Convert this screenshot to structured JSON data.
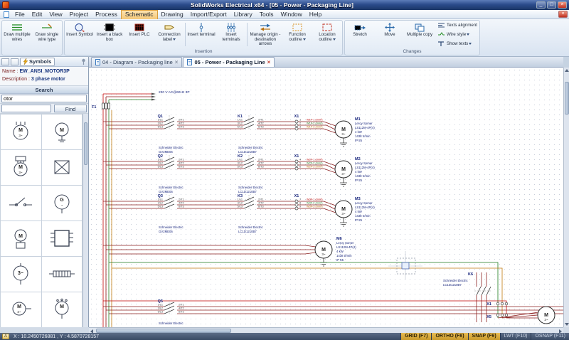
{
  "window": {
    "title": "SolidWorks Electrical x64 - [05 - Power - Packaging Line]"
  },
  "menu": {
    "items": [
      "File",
      "Edit",
      "View",
      "Project",
      "Process",
      "Schematic",
      "Drawing",
      "Import/Export",
      "Library",
      "Tools",
      "Window",
      "Help"
    ]
  },
  "ribbon": {
    "wire_group": {
      "buttons": [
        {
          "label": "Draw multiple wires"
        },
        {
          "label": "Draw single wire type"
        }
      ]
    },
    "insertion_group": {
      "label": "Insertion",
      "buttons": [
        {
          "label": "Insert Symbol"
        },
        {
          "label": "Insert a black box"
        },
        {
          "label": "Insert PLC"
        },
        {
          "label": "Connection label"
        },
        {
          "label": "Insert terminal"
        },
        {
          "label": "Insert terminals"
        },
        {
          "label": "Manage origin - destination arrows"
        },
        {
          "label": "Function outline"
        },
        {
          "label": "Location outline"
        }
      ]
    },
    "changes_group": {
      "label": "Changes",
      "buttons": [
        {
          "label": "Stretch"
        },
        {
          "label": "Move"
        },
        {
          "label": "Multiple copy"
        }
      ],
      "small_buttons": [
        {
          "label": "Texts alignment"
        },
        {
          "label": "Wire style"
        },
        {
          "label": "Show texts"
        }
      ]
    }
  },
  "doc_tabs": [
    {
      "label": "04 - Diagram - Packaging line"
    },
    {
      "label": "05 - Power - Packaging Line"
    }
  ],
  "sidebar": {
    "panel_tab": "Symbols",
    "name_label": "Name :",
    "name_value": "EW_ANSI_MOTOR3P",
    "desc_label": "Description :",
    "desc_value": "3 phase motor",
    "search_title": "Search",
    "search_value": "otor",
    "find_label": "Find",
    "symbols": [
      {
        "glyph": "M",
        "sub": "3~"
      },
      {
        "glyph": "M",
        "sub": ""
      },
      {
        "glyph": "M",
        "sub": "3~"
      },
      {
        "glyph": "",
        "sub": ""
      },
      {
        "glyph": "",
        "sub": ""
      },
      {
        "glyph": "G",
        "sub": "~"
      },
      {
        "glyph": "M",
        "sub": ""
      },
      {
        "glyph": "",
        "sub": ""
      },
      {
        "glyph": "3~",
        "sub": ""
      },
      {
        "glyph": "",
        "sub": ""
      },
      {
        "glyph": "M",
        "sub": "3~"
      },
      {
        "glyph": "M",
        "sub": ""
      }
    ]
  },
  "schematic": {
    "supply_label": "230 V AC@60Hz 3P",
    "fuse_tag": "F1",
    "motor_m": "M",
    "motor_ph": "3~",
    "pins": {
      "l1": "1/L1",
      "l2": "3/L2",
      "l3": "5/L3",
      "t1": "2/T1",
      "t2": "4/T2",
      "t3": "6/T3"
    },
    "branches": [
      {
        "breaker_tag": "Q1",
        "breaker_mfr": "Schneider Electric",
        "breaker_ref": "GV2ME06",
        "contactor_tag": "K1",
        "contactor_mfr": "Schneider Electric",
        "contactor_ref": "LC1D1210B7",
        "terminal_tag": "X1",
        "terminals": [
          "1",
          "2",
          "3"
        ],
        "wire_labels": [
          "W1F-1 (mm²)",
          "W1F-2 (mm²)",
          "W1F-3 (mm²)"
        ],
        "motor_tag": "M1",
        "motor_mfr": "Leroy Somer",
        "motor_ref": "LS112M-4P(4)",
        "motor_power": "4 kW",
        "motor_speed": "1438 tr/min",
        "motor_ip": "IP 55"
      },
      {
        "breaker_tag": "Q2",
        "breaker_mfr": "Schneider Electric",
        "breaker_ref": "GV2ME06",
        "contactor_tag": "K2",
        "contactor_mfr": "Schneider Electric",
        "contactor_ref": "LC1D1210B7",
        "terminal_tag": "X1",
        "terminals": [
          "4",
          "5",
          "6"
        ],
        "wire_labels": [
          "W2F-1 (mm²)",
          "W2F-2 (mm²)",
          "W2F-3 (mm²)"
        ],
        "motor_tag": "M2",
        "motor_mfr": "Leroy Somer",
        "motor_ref": "LS112M-4P(4)",
        "motor_power": "4 kW",
        "motor_speed": "1438 tr/min",
        "motor_ip": "IP 55"
      },
      {
        "breaker_tag": "Q3",
        "breaker_mfr": "Schneider Electric",
        "breaker_ref": "GV2ME06",
        "contactor_tag": "K3",
        "contactor_mfr": "Schneider Electric",
        "contactor_ref": "LC1D1210B7",
        "terminal_tag": "X1",
        "terminals": [
          "7",
          "8",
          "9"
        ],
        "wire_labels": [
          "W3F-1 (mm²)",
          "W3F-2 (mm²)",
          "W3F-3 (mm²)"
        ],
        "motor_tag": "M3",
        "motor_mfr": "Leroy Somer",
        "motor_ref": "LS112M-4P(4)",
        "motor_power": "4 kW",
        "motor_speed": "1438 tr/min",
        "motor_ip": "IP 55"
      }
    ],
    "m6": {
      "tag": "M6",
      "mfr": "Leroy Somer",
      "ref": "LS112M-4P(4)",
      "power": "4 kW",
      "speed": "1438 tr/min",
      "ip": "IP 55"
    },
    "q5": {
      "tag": "Q5",
      "mfr": "Schneider Electric"
    },
    "k6": {
      "tag": "K6",
      "mfr": "Schneider Electric",
      "ref": "LC1D1210B7"
    },
    "x_bottom": {
      "x1": "X1",
      "x5": "X5"
    }
  },
  "statusbar": {
    "badge": "A",
    "coords": "X : 10.2450726881 , Y : 4.5870728157",
    "toggles": [
      {
        "label": "GRID (F7)"
      },
      {
        "label": "ORTHO (F8)"
      },
      {
        "label": "SNAP (F9)"
      },
      {
        "label": "LWT (F10)"
      },
      {
        "label": "OSNAP (F11)"
      }
    ]
  }
}
